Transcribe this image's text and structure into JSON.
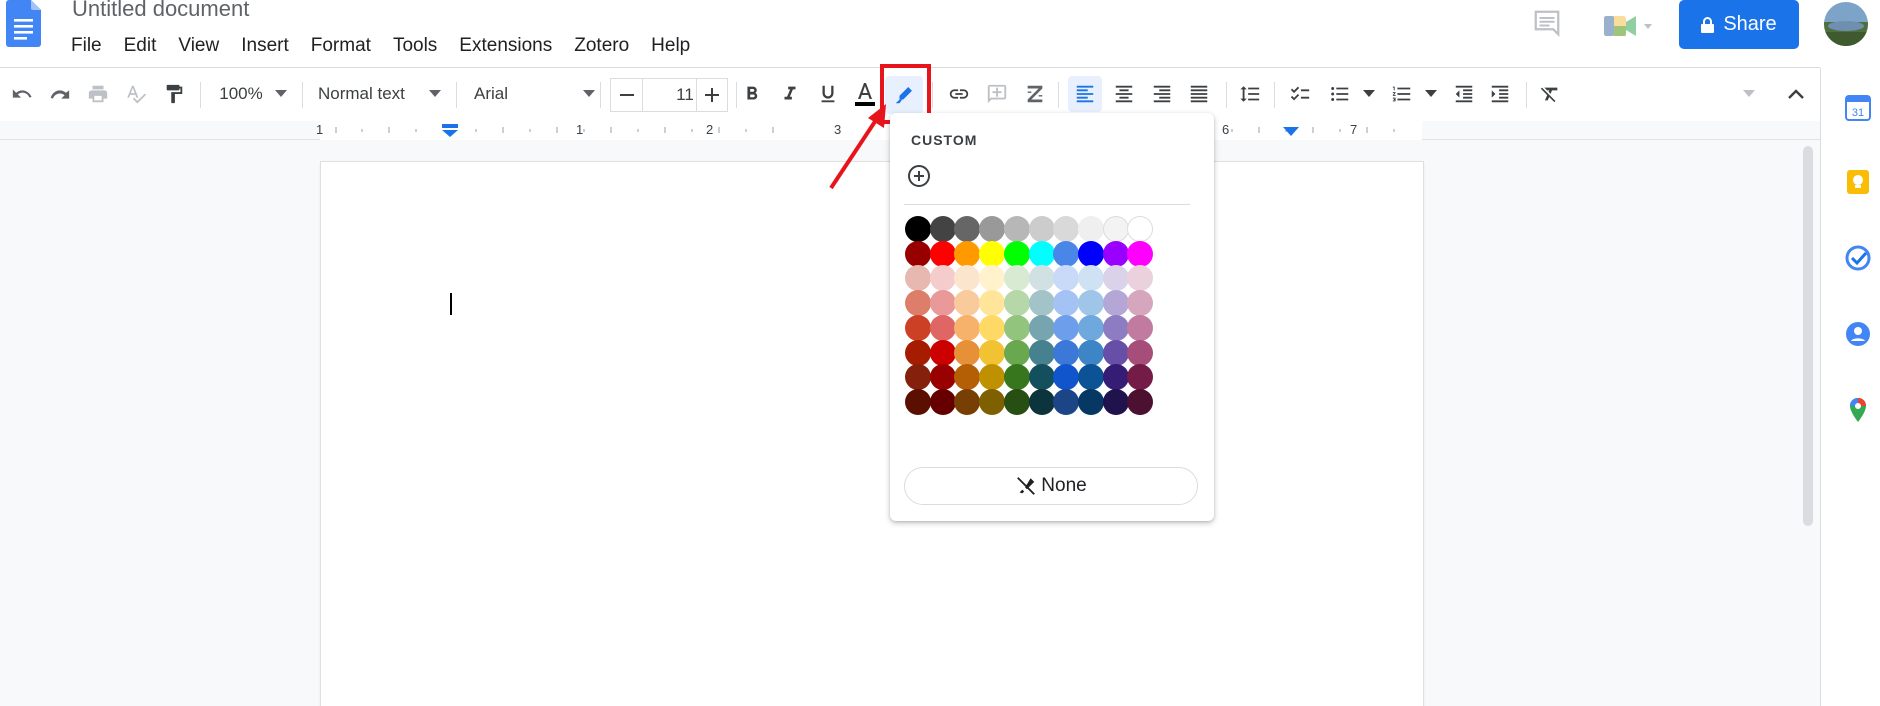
{
  "document": {
    "title": "Untitled document"
  },
  "menu": [
    "File",
    "Edit",
    "View",
    "Insert",
    "Format",
    "Tools",
    "Extensions",
    "Zotero",
    "Help"
  ],
  "header": {
    "share_label": "Share",
    "share_color": "#1a73e8"
  },
  "toolbar": {
    "zoom": "100%",
    "style": "Normal text",
    "font": "Arial",
    "font_size": "11",
    "icons": [
      "undo-icon",
      "redo-icon",
      "print-icon",
      "spellcheck-icon",
      "paint-format-icon",
      "bold-icon",
      "italic-icon",
      "underline-icon",
      "text-color-icon",
      "highlight-color-icon",
      "link-icon",
      "add-comment-icon",
      "insert-image-icon",
      "align-left-icon",
      "align-center-icon",
      "align-right-icon",
      "justify-icon",
      "line-spacing-icon",
      "checklist-icon",
      "bulleted-list-icon",
      "numbered-list-icon",
      "decrease-indent-icon",
      "increase-indent-icon",
      "clear-formatting-icon"
    ]
  },
  "ruler": {
    "labels": [
      "1",
      "1",
      "2",
      "3",
      "6",
      "7"
    ]
  },
  "highlight_palette": {
    "custom_label": "CUSTOM",
    "none_label": "None",
    "grayscale": [
      "#000000",
      "#434343",
      "#666666",
      "#999999",
      "#b7b7b7",
      "#cccccc",
      "#d9d9d9",
      "#efefef",
      "#f3f3f3",
      "#ffffff"
    ],
    "rows": [
      [
        "#980000",
        "#ff0000",
        "#ff9900",
        "#ffff00",
        "#00ff00",
        "#00ffff",
        "#4a86e8",
        "#0000ff",
        "#9900ff",
        "#ff00ff"
      ],
      [
        "#e6b8af",
        "#f4cccc",
        "#fce5cd",
        "#fff2cc",
        "#d9ead3",
        "#d0e0e3",
        "#c9daf8",
        "#cfe2f3",
        "#d9d2e9",
        "#ead1dc"
      ],
      [
        "#dd7e6b",
        "#ea9999",
        "#f9cb9c",
        "#ffe599",
        "#b6d7a8",
        "#a2c4c9",
        "#a4c2f4",
        "#9fc5e8",
        "#b4a7d6",
        "#d5a6bd"
      ],
      [
        "#cc4125",
        "#e06666",
        "#f6b26b",
        "#ffd966",
        "#93c47d",
        "#76a5af",
        "#6d9eeb",
        "#6fa8dc",
        "#8e7cc3",
        "#c27ba0"
      ],
      [
        "#a61c00",
        "#cc0000",
        "#e69138",
        "#f1c232",
        "#6aa84f",
        "#45818e",
        "#3c78d8",
        "#3d85c6",
        "#674ea7",
        "#a64d79"
      ],
      [
        "#85200c",
        "#990000",
        "#b45f06",
        "#bf9000",
        "#38761d",
        "#134f5c",
        "#1155cc",
        "#0b5394",
        "#351c75",
        "#741b47"
      ],
      [
        "#5b0f00",
        "#660000",
        "#783f04",
        "#7f6000",
        "#274e13",
        "#0c343d",
        "#1c4587",
        "#073763",
        "#20124d",
        "#4c1130"
      ]
    ]
  },
  "annotation_color": "#e8141b"
}
